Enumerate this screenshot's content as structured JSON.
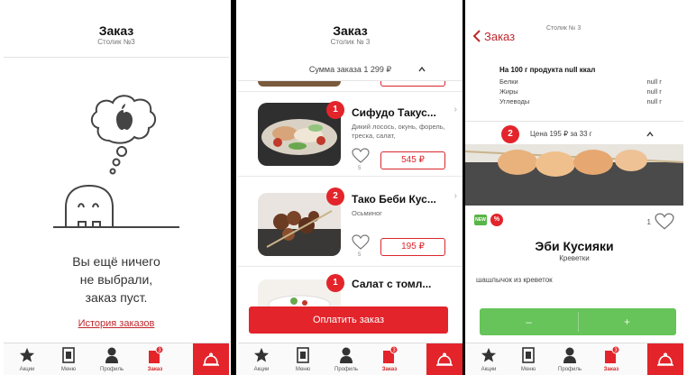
{
  "screen1": {
    "title": "Заказ",
    "subtitle": "Столик №3",
    "empty_lines": [
      "Вы ещё ничего",
      "не выбрали,",
      "заказ пуст."
    ],
    "history_link": "История заказов"
  },
  "screen2": {
    "title": "Заказ",
    "subtitle": "Столик № 3",
    "sum_label": "Сумма заказа 1 299 ₽",
    "items": [
      {
        "qty": "1",
        "name": "Сифудо Такус...",
        "desc": "Дикий лосось, окунь, форель, треска, салат,",
        "likes": "5",
        "price": "545 ₽"
      },
      {
        "qty": "2",
        "name": "Тако Беби Кус...",
        "desc": "Осьминог",
        "likes": "5",
        "price": "195 ₽"
      },
      {
        "qty": "1",
        "name": "Салат с томл..."
      }
    ],
    "pay_button": "Оплатить заказ"
  },
  "screen3": {
    "back_label": "Заказ",
    "subtitle": "Столик № 3",
    "nutrition_title": "На 100 г продукта null ккал",
    "nutrition": [
      {
        "label": "Белки",
        "value": "null г"
      },
      {
        "label": "Жиры",
        "value": "null г"
      },
      {
        "label": "Углеводы",
        "value": "null г"
      }
    ],
    "qty": "2",
    "price_line": "Цена 195 ₽ за 33 г",
    "tag_new": "NEW",
    "tag_sale": "%",
    "likes": "1",
    "dish_name": "Эби Кусияки",
    "dish_category": "Креветки",
    "dish_desc": "шашлычок из креветок",
    "minus": "–",
    "plus": "+"
  },
  "tabs": [
    {
      "label": "Акции",
      "icon": "star-icon"
    },
    {
      "label": "Меню",
      "icon": "menu-book-icon"
    },
    {
      "label": "Профиль",
      "icon": "profile-icon"
    },
    {
      "label": "Заказ",
      "icon": "order-bag-icon",
      "active": true
    }
  ],
  "tab_badge": "3",
  "colors": {
    "accent": "#e3242b",
    "green": "#66c45a"
  }
}
